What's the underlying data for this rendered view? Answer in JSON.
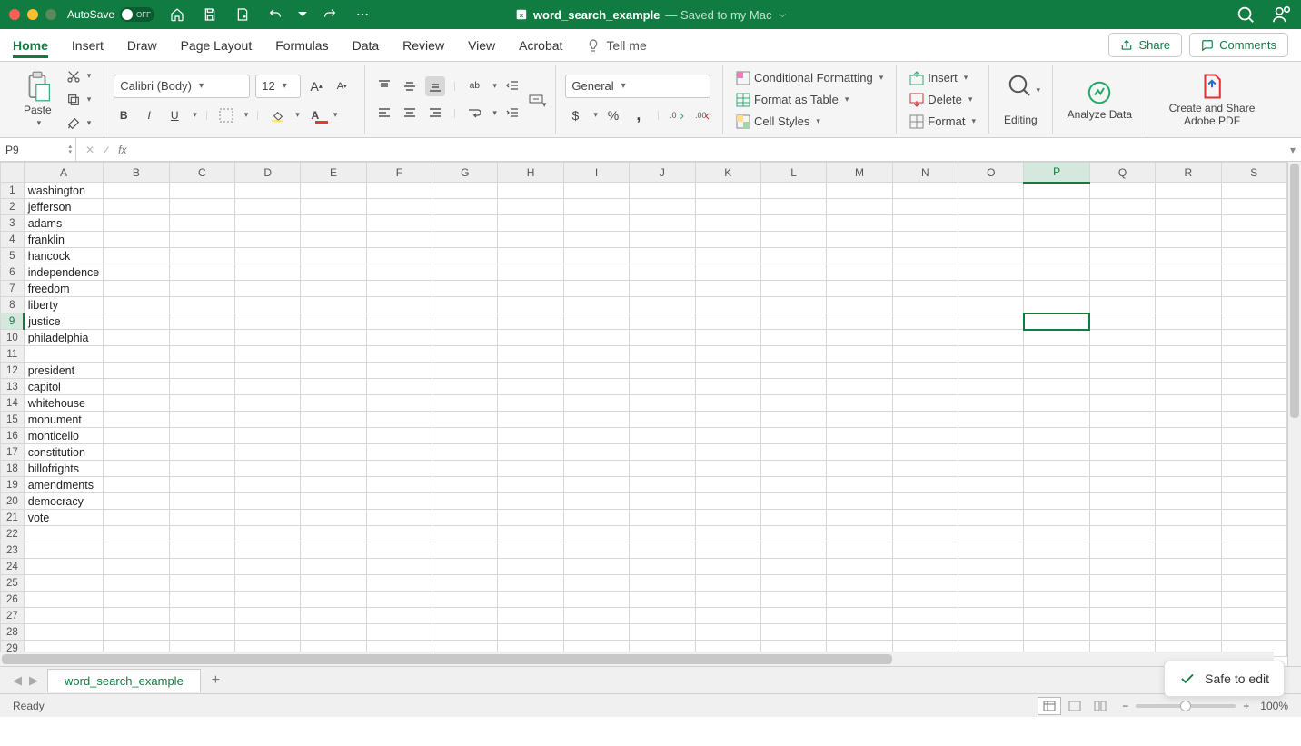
{
  "titlebar": {
    "autosave_label": "AutoSave",
    "autosave_state": "OFF",
    "doc_icon": "excel-doc-icon",
    "doc_name": "word_search_example",
    "saved_text": " — Saved to my Mac"
  },
  "tabs": {
    "items": [
      "Home",
      "Insert",
      "Draw",
      "Page Layout",
      "Formulas",
      "Data",
      "Review",
      "View",
      "Acrobat"
    ],
    "active": "Home",
    "tell_me": "Tell me",
    "share": "Share",
    "comments": "Comments"
  },
  "ribbon": {
    "paste": "Paste",
    "font_name": "Calibri (Body)",
    "font_size": "12",
    "number_format": "General",
    "cond_fmt": "Conditional Formatting",
    "fmt_table": "Format as Table",
    "cell_styles": "Cell Styles",
    "insert": "Insert",
    "delete": "Delete",
    "format": "Format",
    "editing": "Editing",
    "analyze": "Analyze Data",
    "adobe": "Create and Share Adobe PDF"
  },
  "formula_bar": {
    "name_box": "P9",
    "formula": ""
  },
  "grid": {
    "columns": [
      "A",
      "B",
      "C",
      "D",
      "E",
      "F",
      "G",
      "H",
      "I",
      "J",
      "K",
      "L",
      "M",
      "N",
      "O",
      "P",
      "Q",
      "R",
      "S"
    ],
    "row_count": 29,
    "active_cell": {
      "col": "P",
      "row": 9
    },
    "cells": {
      "A1": "washington",
      "A2": "jefferson",
      "A3": "adams",
      "A4": "franklin",
      "A5": "hancock",
      "A6": "independence",
      "A7": "freedom",
      "A8": "liberty",
      "A9": "justice",
      "A10": "philadelphia",
      "A12": "president",
      "A13": "capitol",
      "A14": "whitehouse",
      "A15": "monument",
      "A16": "monticello",
      "A17": "constitution",
      "A18": "billofrights",
      "A19": "amendments",
      "A20": "democracy",
      "A21": "vote"
    }
  },
  "sheet_tabs": {
    "active": "word_search_example"
  },
  "safe_to_edit": "Safe to edit",
  "statusbar": {
    "ready": "Ready",
    "zoom": "100%"
  }
}
